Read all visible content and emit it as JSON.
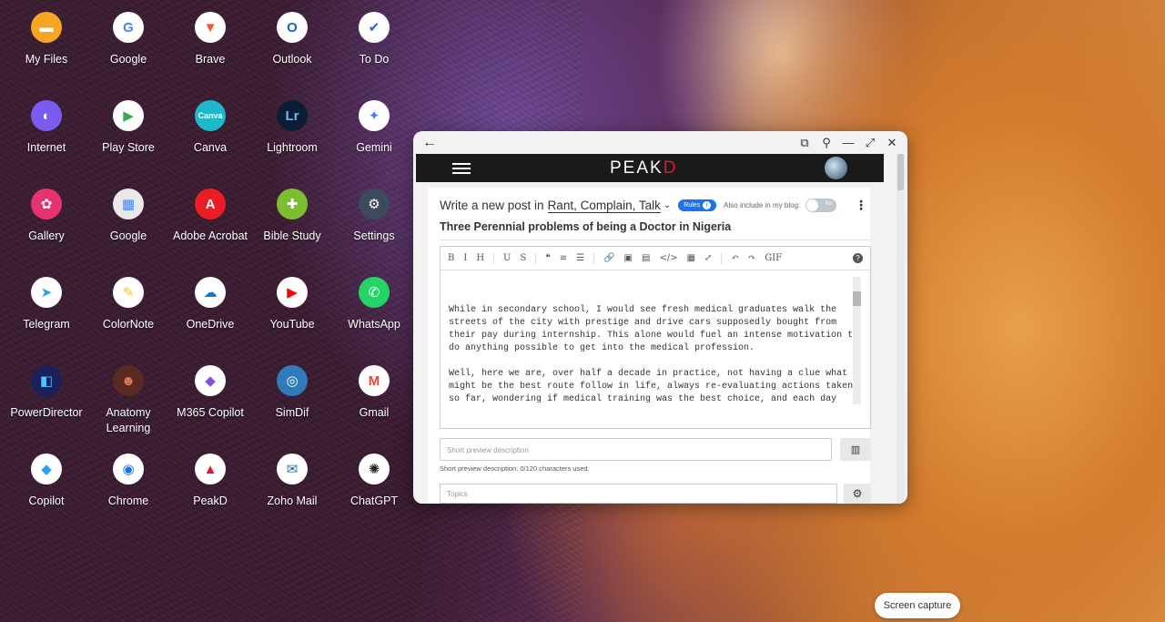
{
  "apps": [
    {
      "label": "My Files",
      "glyph": "▬",
      "icon": "folder-icon",
      "color": "#f5a623",
      "fg": "#fff"
    },
    {
      "label": "Google",
      "glyph": "G",
      "icon": "google-icon",
      "color": "#ffffff",
      "fg": "#4285f4"
    },
    {
      "label": "Brave",
      "glyph": "▼",
      "icon": "brave-icon",
      "color": "#ffffff",
      "fg": "#fb542b"
    },
    {
      "label": "Outlook",
      "glyph": "O",
      "icon": "outlook-icon",
      "color": "#ffffff",
      "fg": "#0f6cbd"
    },
    {
      "label": "To Do",
      "glyph": "✔",
      "icon": "todo-icon",
      "color": "#ffffff",
      "fg": "#2564cf"
    },
    {
      "label": "Internet",
      "glyph": "◐",
      "icon": "internet-icon",
      "color": "#7a5cf0",
      "fg": "#fff"
    },
    {
      "label": "Play Store",
      "glyph": "▶",
      "icon": "play-store-icon",
      "color": "#ffffff",
      "fg": "#34a853"
    },
    {
      "label": "Canva",
      "glyph": "Canva",
      "icon": "canva-icon",
      "color": "#1db8c9",
      "fg": "#fff"
    },
    {
      "label": "Lightroom",
      "glyph": "Lr",
      "icon": "lightroom-icon",
      "color": "#0b1e33",
      "fg": "#6fb6ff"
    },
    {
      "label": "Gemini",
      "glyph": "✦",
      "icon": "gemini-icon",
      "color": "#ffffff",
      "fg": "#4a7cf3"
    },
    {
      "label": "Gallery",
      "glyph": "✿",
      "icon": "gallery-icon",
      "color": "#e6336f",
      "fg": "#fff"
    },
    {
      "label": "Google",
      "glyph": "▦",
      "icon": "google-folder-icon",
      "color": "#e9e9e9",
      "fg": "#4285f4"
    },
    {
      "label": "Adobe Acrobat",
      "glyph": "A",
      "icon": "acrobat-icon",
      "color": "#ec1c24",
      "fg": "#fff"
    },
    {
      "label": "Bible Study",
      "glyph": "✚",
      "icon": "bible-study-icon",
      "color": "#7cbf2e",
      "fg": "#fff"
    },
    {
      "label": "Settings",
      "glyph": "⚙",
      "icon": "settings-icon",
      "color": "#3b4a5c",
      "fg": "#fff"
    },
    {
      "label": "Telegram",
      "glyph": "➤",
      "icon": "telegram-icon",
      "color": "#ffffff",
      "fg": "#2aa3df"
    },
    {
      "label": "ColorNote",
      "glyph": "✎",
      "icon": "colornote-icon",
      "color": "#ffffff",
      "fg": "#e8c53a"
    },
    {
      "label": "OneDrive",
      "glyph": "☁",
      "icon": "onedrive-icon",
      "color": "#ffffff",
      "fg": "#0f78d4"
    },
    {
      "label": "YouTube",
      "glyph": "▶",
      "icon": "youtube-icon",
      "color": "#ffffff",
      "fg": "#ff0000"
    },
    {
      "label": "WhatsApp",
      "glyph": "✆",
      "icon": "whatsapp-icon",
      "color": "#25d366",
      "fg": "#fff"
    },
    {
      "label": "PowerDirector",
      "glyph": "◧",
      "icon": "powerdirector-icon",
      "color": "#1b1f5c",
      "fg": "#49c6ff"
    },
    {
      "label": "Anatomy Learning",
      "glyph": "☻",
      "icon": "anatomy-learning-icon",
      "color": "#5a2a22",
      "fg": "#e07b5b"
    },
    {
      "label": "M365 Copilot",
      "glyph": "◆",
      "icon": "m365-copilot-icon",
      "color": "#ffffff",
      "fg": "#7f54d9"
    },
    {
      "label": "SimDif",
      "glyph": "◎",
      "icon": "simdif-icon",
      "color": "#2e7db8",
      "fg": "#fff"
    },
    {
      "label": "Gmail",
      "glyph": "M",
      "icon": "gmail-icon",
      "color": "#ffffff",
      "fg": "#ea4335"
    },
    {
      "label": "Copilot",
      "glyph": "◆",
      "icon": "copilot-icon",
      "color": "#ffffff",
      "fg": "#2aa0f0"
    },
    {
      "label": "Chrome",
      "glyph": "◉",
      "icon": "chrome-icon",
      "color": "#ffffff",
      "fg": "#1a73e8"
    },
    {
      "label": "PeakD",
      "glyph": "▲",
      "icon": "peakd-icon",
      "color": "#ffffff",
      "fg": "#e31337"
    },
    {
      "label": "Zoho Mail",
      "glyph": "✉",
      "icon": "zoho-mail-icon",
      "color": "#ffffff",
      "fg": "#226db4"
    },
    {
      "label": "ChatGPT",
      "glyph": "✺",
      "icon": "chatgpt-icon",
      "color": "#ffffff",
      "fg": "#222"
    }
  ],
  "window": {
    "back_glyph": "←",
    "controls": [
      "⧉",
      "⚲",
      "—",
      "⤢",
      "✕"
    ],
    "logo_main": "PEAK",
    "logo_accent": "D",
    "accent_color": "#e31337"
  },
  "post": {
    "write_prefix": "Write a new post in",
    "community": "Rant, Complain, Talk",
    "rules_label": "Rules",
    "also_include": "Also include in my blog:",
    "toggle_value": "No",
    "title": "Three Perennial problems of being a Doctor in Nigeria",
    "body": "\n\nWhile in secondary school, I would see fresh medical graduates walk the streets of the city with prestige and drive cars supposedly bought from their pay during internship. This alone would fuel an intense motivation to do anything possible to get into the medical profession.\n\nWell, here we are, over half a decade in practice, not having a clue what might be the best route follow in life, always re-evaluating actions taken so far, wondering if medical training was the best choice, and each day nursing an ever",
    "toolbar": [
      "B",
      "I",
      "H",
      "U",
      "S",
      "❝",
      "≡",
      "☰",
      "🔗",
      "▣",
      "▤",
      "</>",
      "▦",
      "⤢",
      "↶",
      "↷",
      "GIF"
    ],
    "help_glyph": "?",
    "preview_placeholder": "Short preview description",
    "preview_note": "Short preview description: 0/120 characters used.",
    "topics_placeholder": "Topics"
  },
  "toast": "Screen capture"
}
